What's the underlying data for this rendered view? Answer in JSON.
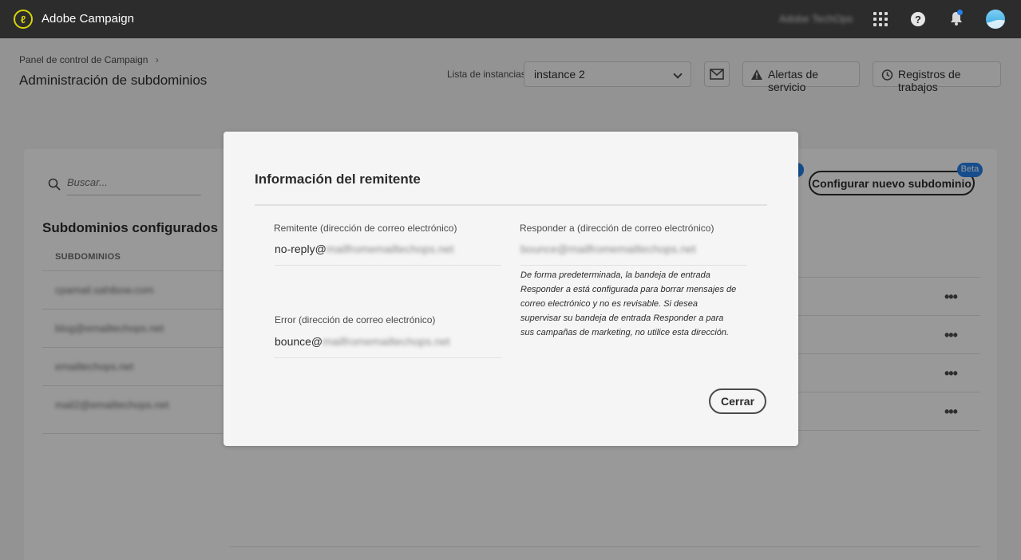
{
  "app": {
    "title": "Adobe Campaign",
    "org_name": "Adobe TechOps"
  },
  "header": {
    "breadcrumb": "Panel de control de Campaign",
    "page_title": "Administración de subdominios",
    "instance_label": "Lista de instancias",
    "instance_value": "instance 2",
    "alerts_label": "Alertas de servicio",
    "jobs_label": "Registros de trabajos"
  },
  "main": {
    "search_placeholder": "Buscar...",
    "section_title": "Subdominios configurados",
    "column_header": "SUBDOMINIOS",
    "subdomains": [
      "cpamail.sahibow.com",
      "blog@emailtechops.net",
      "emailtechops.net",
      "mail2@emailtechops.net"
    ],
    "row_menu": "•••",
    "config_button": "Configurar nuevo subdominio",
    "beta_badge": "Beta"
  },
  "dialog": {
    "title": "Información del remitente",
    "sender_label": "Remitente (dirección de correo electrónico)",
    "sender_prefix": "no-reply@",
    "sender_domain": "mailfromemailtechops.net",
    "reply_label": "Responder a (dirección de correo electrónico)",
    "reply_value": "bounce@mailfromemailtechops.net",
    "error_label": "Error (dirección de correo electrónico)",
    "error_prefix": "bounce@",
    "error_domain": "mailfromemailtechops.net",
    "help_text": "De forma predeterminada, la bandeja de entrada Responder a está configurada para borrar mensajes de correo electrónico y no es revisable. Si desea supervisar su bandeja de entrada Responder a para sus campañas de marketing, no utilice esta dirección.",
    "close_label": "Cerrar"
  },
  "icons": [
    "adobe-campaign-logo-icon",
    "apps-grid-icon",
    "help-icon",
    "bell-icon",
    "avatar",
    "chevron-down-icon",
    "mail-icon",
    "alert-icon",
    "history-icon",
    "search-icon",
    "more-icon"
  ],
  "colors": {
    "topbar": "#2c2c2c",
    "accent": "#2680eb",
    "logo": "#d4d40b"
  }
}
